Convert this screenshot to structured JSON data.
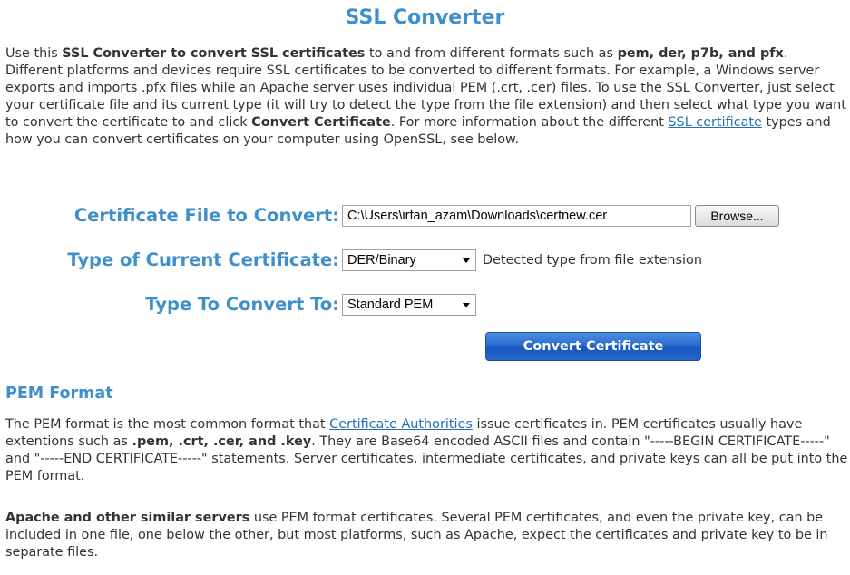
{
  "page_title": "SSL Converter",
  "intro": {
    "t1": "Use this ",
    "b1": "SSL Converter to convert SSL certificates",
    "t2": " to and from different formats such as ",
    "b2": "pem, der, p7b, and pfx",
    "t3": ". Different platforms and devices require SSL certificates to be converted to different formats. For example, a Windows server exports and imports .pfx files while an Apache server uses individual PEM (.crt, .cer) files. To use the SSL Converter, just select your certificate file and its current type (it will try to detect the type from the file extension) and then select what type you want to convert the certificate to and click ",
    "b3": "Convert Certificate",
    "t4": ". For more information about the different ",
    "link": "SSL certificate",
    "t5": " types and how you can convert certificates on your computer using OpenSSL, see below."
  },
  "form": {
    "file_label": "Certificate File to Convert:",
    "file_value": "C:\\Users\\irfan_azam\\Downloads\\certnew.cer",
    "browse_label": "Browse...",
    "current_type_label": "Type of Current Certificate:",
    "current_type_value": "DER/Binary",
    "detected_hint": "Detected type from file extension",
    "convert_to_label": "Type To Convert To:",
    "convert_to_value": "Standard PEM",
    "convert_button": "Convert Certificate"
  },
  "pem_section": {
    "heading": "PEM Format",
    "p1": {
      "t1": "The PEM format is the most common format that ",
      "link": "Certificate Authorities",
      "t2": " issue certificates in. PEM certificates usually have extentions such as ",
      "b1": ".pem, .crt, .cer, and .key",
      "t3": ". They are Base64 encoded ASCII files and contain \"-----BEGIN CERTIFICATE-----\" and \"-----END CERTIFICATE-----\" statements. Server certificates, intermediate certificates, and private keys can all be put into the PEM format."
    },
    "p2": {
      "b1": "Apache and other similar servers",
      "t1": " use PEM format certificates. Several PEM certificates, and even the private key, can be included in one file, one below the other, but most platforms, such as Apache, expect the certificates and private key to be in separate files."
    }
  }
}
